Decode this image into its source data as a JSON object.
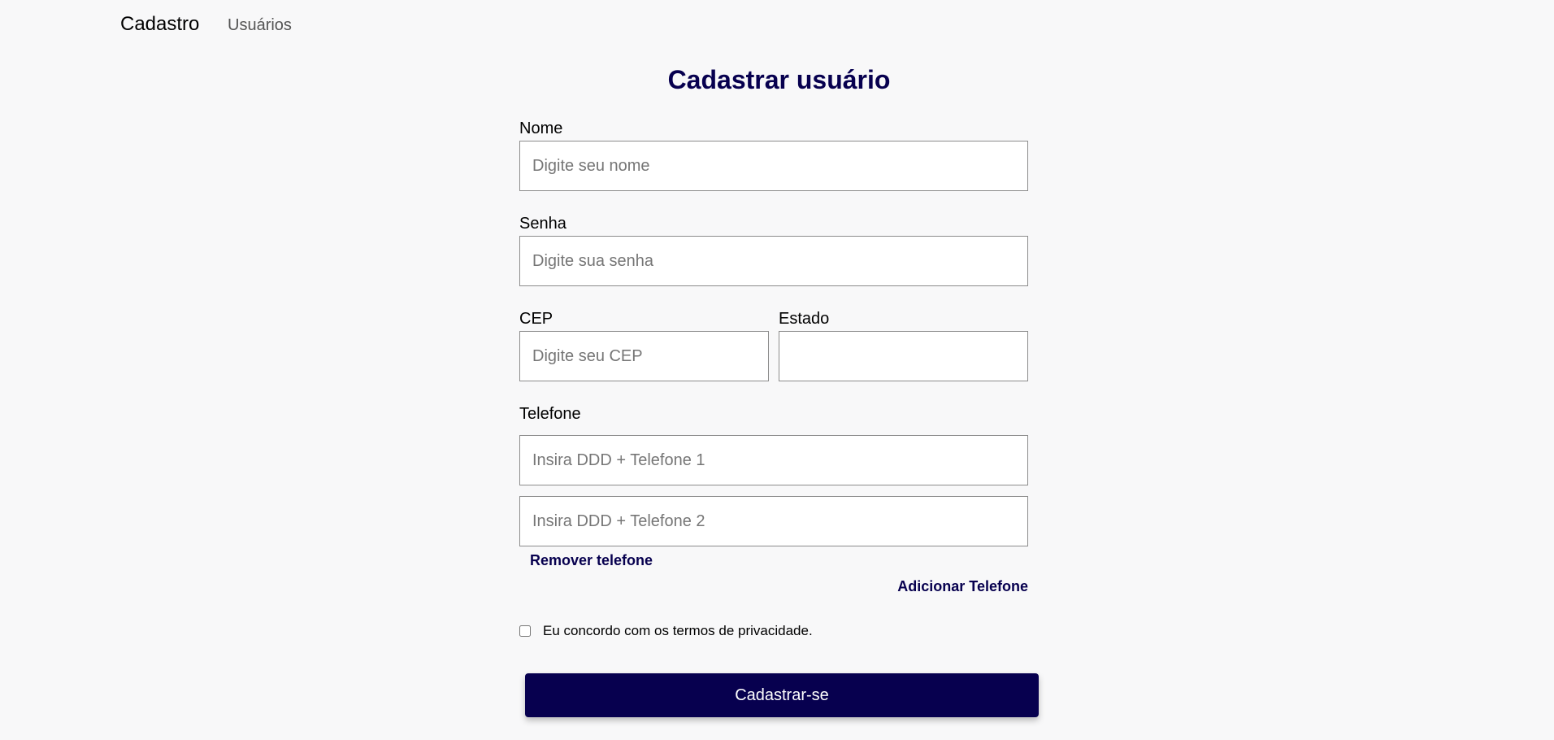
{
  "navbar": {
    "brand": "Cadastro",
    "links": [
      {
        "label": "Usuários"
      }
    ]
  },
  "form": {
    "title": "Cadastrar usuário",
    "nome": {
      "label": "Nome",
      "placeholder": "Digite seu nome",
      "value": ""
    },
    "senha": {
      "label": "Senha",
      "placeholder": "Digite sua senha",
      "value": ""
    },
    "cep": {
      "label": "CEP",
      "placeholder": "Digite seu CEP",
      "value": ""
    },
    "estado": {
      "label": "Estado",
      "value": ""
    },
    "telefone": {
      "label": "Telefone",
      "phones": [
        {
          "placeholder": "Insira DDD + Telefone 1",
          "value": ""
        },
        {
          "placeholder": "Insira DDD + Telefone 2",
          "value": ""
        }
      ],
      "remove_label": "Remover telefone",
      "add_label": "Adicionar Telefone"
    },
    "terms": {
      "label": "Eu concordo com os termos de privacidade.",
      "checked": false
    },
    "submit_label": "Cadastrar-se"
  },
  "colors": {
    "primary": "#07004f",
    "background": "#f8f8f9",
    "input_border": "#8c8c8c"
  }
}
